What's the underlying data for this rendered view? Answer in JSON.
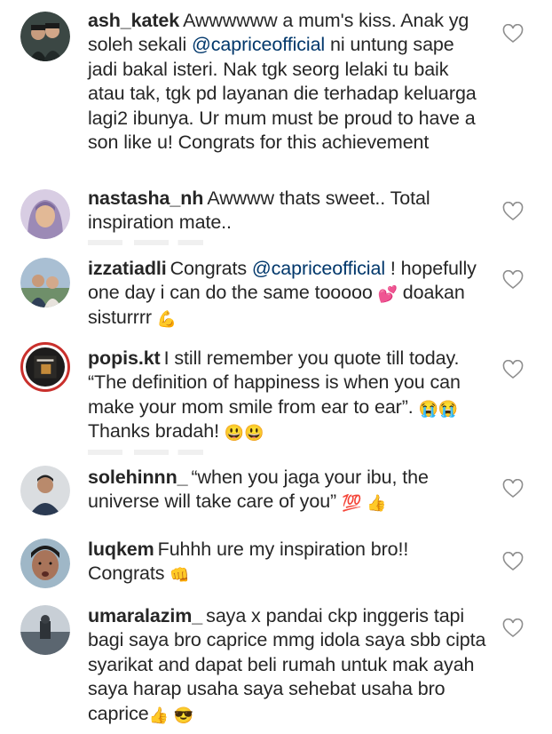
{
  "comments": [
    {
      "username": "ash_katek",
      "parts": [
        "Awwwwww a mum's kiss. Anak yg soleh sekali ",
        "@capriceofficial",
        " ni untung sape jadi bakal isteri. Nak tgk seorg lelaki tu baik atau tak, tgk pd layanan die terhadap keluarga lagi2 ibunya. Ur mum must be proud to have a son like u! Congrats for this achievement"
      ],
      "avatar_color": "#2f3a38"
    },
    {
      "username": "nastasha_nh",
      "parts": [
        "Awwww thats sweet.. Total inspiration mate.."
      ],
      "avatar_color": "#c9b9d9"
    },
    {
      "username": "izzatiadli",
      "parts": [
        "Congrats ",
        "@capriceofficial",
        " ! hopefully one day i can do the same tooooo ",
        "💕",
        " doakan sisturrrr ",
        "💪"
      ],
      "avatar_color": "#8fa3b8"
    },
    {
      "username": "popis.kt",
      "parts": [
        "I still remember you quote till today. “The definition of happiness is when you can make your mom smile from ear to ear”. ",
        "😭😭",
        " Thanks bradah! ",
        "😃😃"
      ],
      "avatar_color": "#1d1c1c"
    },
    {
      "username": "solehinnn_",
      "parts": [
        "“when you jaga your ibu, the universe will take care of you” ",
        "💯",
        " ",
        "👍"
      ],
      "avatar_color": "#c9ccd0"
    },
    {
      "username": "luqkem",
      "parts": [
        "Fuhhh ure my inspiration bro!! Congrats ",
        "👊"
      ],
      "avatar_color": "#8f6a55"
    },
    {
      "username": "umaralazim_",
      "parts": [
        "saya x pandai ckp inggeris tapi bagi saya bro caprice mmg idola saya sbb cipta syarikat and dapat beli rumah untuk mak ayah saya harap usaha saya sehebat usaha bro caprice",
        "👍",
        " ",
        "😎"
      ],
      "avatar_color": "#6b7580"
    }
  ],
  "colors": {
    "text": "#262626",
    "mention": "#00376b",
    "story_ring": "#c9302c",
    "heart": "#8e8e8e"
  }
}
